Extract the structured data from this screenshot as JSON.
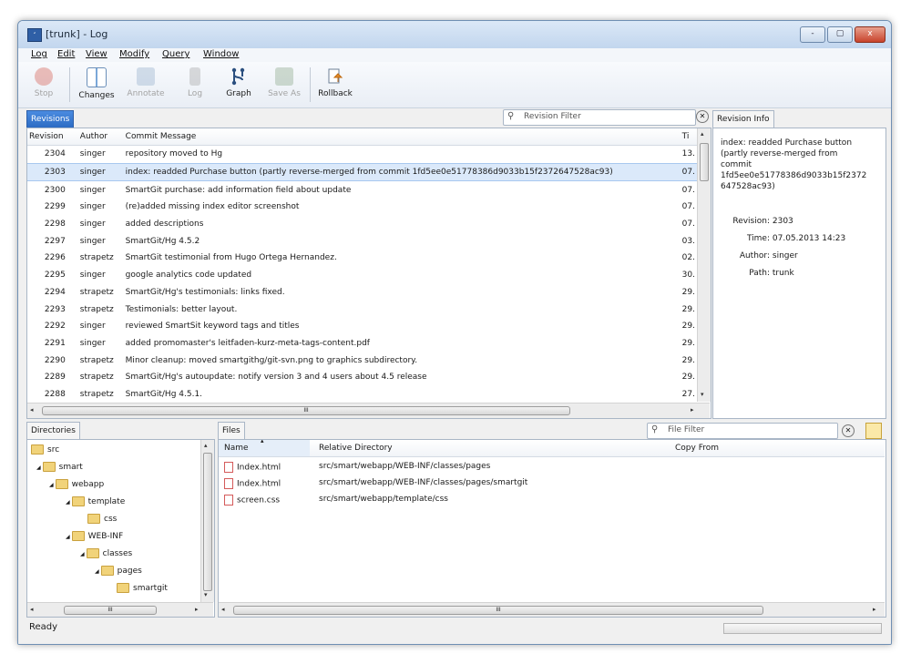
{
  "window": {
    "title": "[trunk] - Log",
    "min": "-",
    "max": "▢",
    "close": "x"
  },
  "menu": [
    "Log",
    "Edit",
    "View",
    "Modify",
    "Query",
    "Window"
  ],
  "toolbar": [
    {
      "label": "Stop",
      "icon": "stop-icon",
      "enabled": false
    },
    {
      "label": "Changes",
      "icon": "changes-icon",
      "enabled": true
    },
    {
      "label": "Annotate",
      "icon": "annotate-icon",
      "enabled": false
    },
    {
      "label": "Log",
      "icon": "log-icon",
      "enabled": false
    },
    {
      "label": "Graph",
      "icon": "graph-icon",
      "enabled": true
    },
    {
      "label": "Save As",
      "icon": "save-as-icon",
      "enabled": false
    },
    {
      "label": "Rollback",
      "icon": "rollback-icon",
      "enabled": true
    }
  ],
  "revisions": {
    "tab": "Revisions",
    "filter_placeholder": "Revision Filter",
    "columns": [
      "Revision",
      "Author",
      "Commit Message",
      "Ti"
    ],
    "rows": [
      {
        "rev": "2304",
        "author": "singer",
        "msg": "repository moved to Hg",
        "time": "13."
      },
      {
        "rev": "2303",
        "author": "singer",
        "msg": "index: readded Purchase button (partly reverse-merged from commit 1fd5ee0e51778386d9033b15f2372647528ac93)",
        "time": "07."
      },
      {
        "rev": "2300",
        "author": "singer",
        "msg": "SmartGit purchase: add information field about update",
        "time": "07."
      },
      {
        "rev": "2299",
        "author": "singer",
        "msg": "(re)added missing index editor screenshot",
        "time": "07."
      },
      {
        "rev": "2298",
        "author": "singer",
        "msg": "added descriptions",
        "time": "07."
      },
      {
        "rev": "2297",
        "author": "singer",
        "msg": "SmartGit/Hg 4.5.2",
        "time": "03."
      },
      {
        "rev": "2296",
        "author": "strapetz",
        "msg": "SmartGit testimonial from Hugo Ortega Hernandez.",
        "time": "02."
      },
      {
        "rev": "2295",
        "author": "singer",
        "msg": "google analytics code updated",
        "time": "30."
      },
      {
        "rev": "2294",
        "author": "strapetz",
        "msg": "SmartGit/Hg's testimonials: links fixed.",
        "time": "29."
      },
      {
        "rev": "2293",
        "author": "strapetz",
        "msg": "Testimonials: better layout.",
        "time": "29."
      },
      {
        "rev": "2292",
        "author": "singer",
        "msg": "reviewed SmartSit keyword tags and titles",
        "time": "29."
      },
      {
        "rev": "2291",
        "author": "singer",
        "msg": "added promomaster's leitfaden-kurz-meta-tags-content.pdf",
        "time": "29."
      },
      {
        "rev": "2290",
        "author": "strapetz",
        "msg": "Minor cleanup: moved smartgithg/git-svn.png to graphics subdirectory.",
        "time": "29."
      },
      {
        "rev": "2289",
        "author": "strapetz",
        "msg": "SmartGit/Hg's autoupdate: notify version 3 and 4 users about 4.5 release",
        "time": "29."
      },
      {
        "rev": "2288",
        "author": "strapetz",
        "msg": "SmartGit/Hg 4.5.1.",
        "time": "27."
      }
    ]
  },
  "revision_info": {
    "tab": "Revision Info",
    "message_lines": [
      "index: readded Purchase button",
      "(partly reverse-merged from",
      "commit",
      "1fd5ee0e51778386d9033b15f2372",
      "647528ac93)"
    ],
    "fields": [
      {
        "label": "Revision:",
        "value": "2303"
      },
      {
        "label": "Time:",
        "value": "07.05.2013 14:23"
      },
      {
        "label": "Author:",
        "value": "singer"
      },
      {
        "label": "Path:",
        "value": "trunk"
      }
    ]
  },
  "directories": {
    "tab": "Directories",
    "nodes": [
      {
        "name": "src",
        "expander": ""
      },
      {
        "name": "smart",
        "expander": "◢"
      },
      {
        "name": "webapp",
        "expander": "◢"
      },
      {
        "name": "template",
        "expander": "◢"
      },
      {
        "name": "css",
        "expander": ""
      },
      {
        "name": "WEB-INF",
        "expander": "◢"
      },
      {
        "name": "classes",
        "expander": "◢"
      },
      {
        "name": "pages",
        "expander": "◢"
      },
      {
        "name": "smartgit",
        "expander": ""
      }
    ]
  },
  "files": {
    "tab": "Files",
    "filter_placeholder": "File Filter",
    "columns": [
      "Name",
      "Relative Directory",
      "Copy From"
    ],
    "rows": [
      {
        "name": "Index.html",
        "dir": "src/smart/webapp/WEB-INF/classes/pages",
        "copy": ""
      },
      {
        "name": "Index.html",
        "dir": "src/smart/webapp/WEB-INF/classes/pages/smartgit",
        "copy": ""
      },
      {
        "name": "screen.css",
        "dir": "src/smart/webapp/template/css",
        "copy": ""
      }
    ]
  },
  "scroll": {
    "grip": "III",
    "left": "◂",
    "right": "▸",
    "up": "▴",
    "down": "▾",
    "sort": "▴"
  },
  "status": {
    "text": "Ready",
    "progress": 0
  }
}
